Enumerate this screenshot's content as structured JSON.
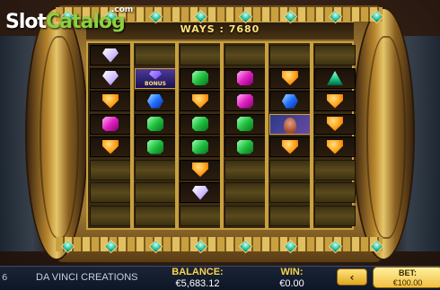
{
  "logo": {
    "slot": "Slot",
    "catalog": "Catalog",
    "com": ".com"
  },
  "game": {
    "ways_label": "WAYS : 7680",
    "bonus_label": "BONUS"
  },
  "bottom_bar": {
    "left_num": "6",
    "provider": "DA VINCI CREATIONS",
    "balance_label": "BALANCE:",
    "balance_value": "€5,683.12",
    "win_label": "WIN:",
    "win_value": "€0.00",
    "back_symbol": "‹",
    "bet_label": "BET:",
    "bet_value": "€100.00"
  },
  "colors": {
    "accent_gold": "#ffd24a",
    "logo_green": "#8ad040"
  },
  "reels": [
    [
      "diamond",
      "diamond",
      "shield",
      "pink",
      "shield",
      "empty",
      "empty",
      "empty"
    ],
    [
      "empty",
      "bonus",
      "sapphire",
      "emerald",
      "emerald",
      "empty",
      "empty",
      "empty"
    ],
    [
      "empty",
      "emerald",
      "shield",
      "emerald",
      "emerald",
      "shield",
      "diamond",
      "empty"
    ],
    [
      "empty",
      "pink",
      "pink",
      "emerald",
      "emerald",
      "empty",
      "empty",
      "empty"
    ],
    [
      "empty",
      "shield",
      "sapphire",
      "portrait",
      "shield",
      "empty",
      "empty",
      "empty"
    ],
    [
      "empty",
      "triangle",
      "shield",
      "shield",
      "shield",
      "empty",
      "empty",
      "empty"
    ]
  ]
}
